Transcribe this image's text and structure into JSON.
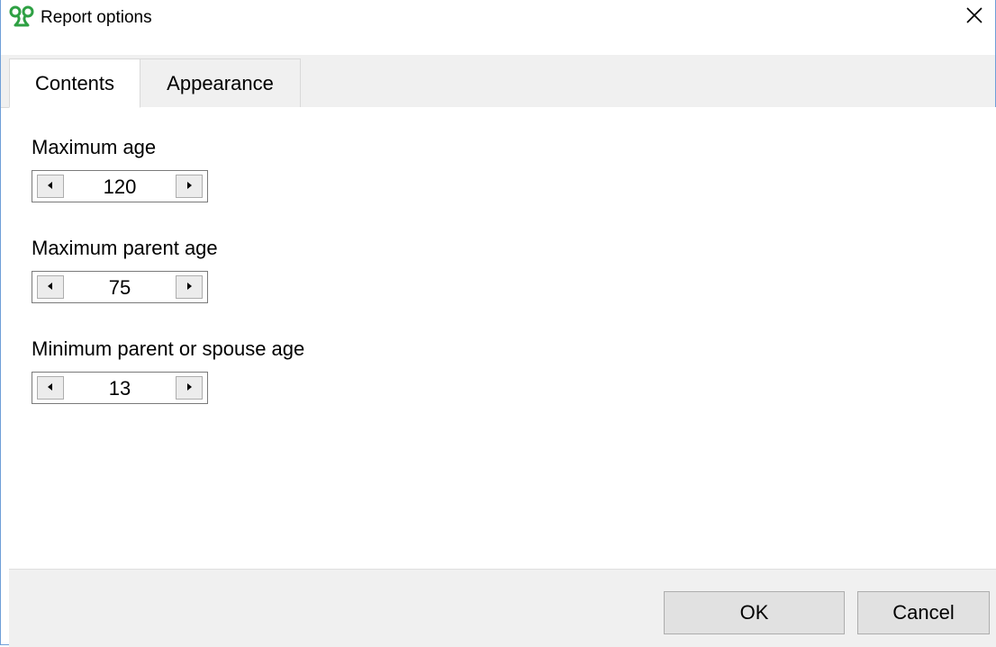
{
  "window": {
    "title": "Report options",
    "app_icon": "app-logo-icon",
    "close_icon": "close-icon"
  },
  "tabs": [
    {
      "label": "Contents",
      "selected": true
    },
    {
      "label": "Appearance",
      "selected": false
    }
  ],
  "fields": [
    {
      "label": "Maximum age",
      "value": "120"
    },
    {
      "label": "Maximum parent age",
      "value": "75"
    },
    {
      "label": "Minimum parent or spouse age",
      "value": "13"
    }
  ],
  "buttons": {
    "ok_label": "OK",
    "cancel_label": "Cancel"
  },
  "colors": {
    "accent_green": "#34a853",
    "window_border": "#6f9fd8"
  }
}
